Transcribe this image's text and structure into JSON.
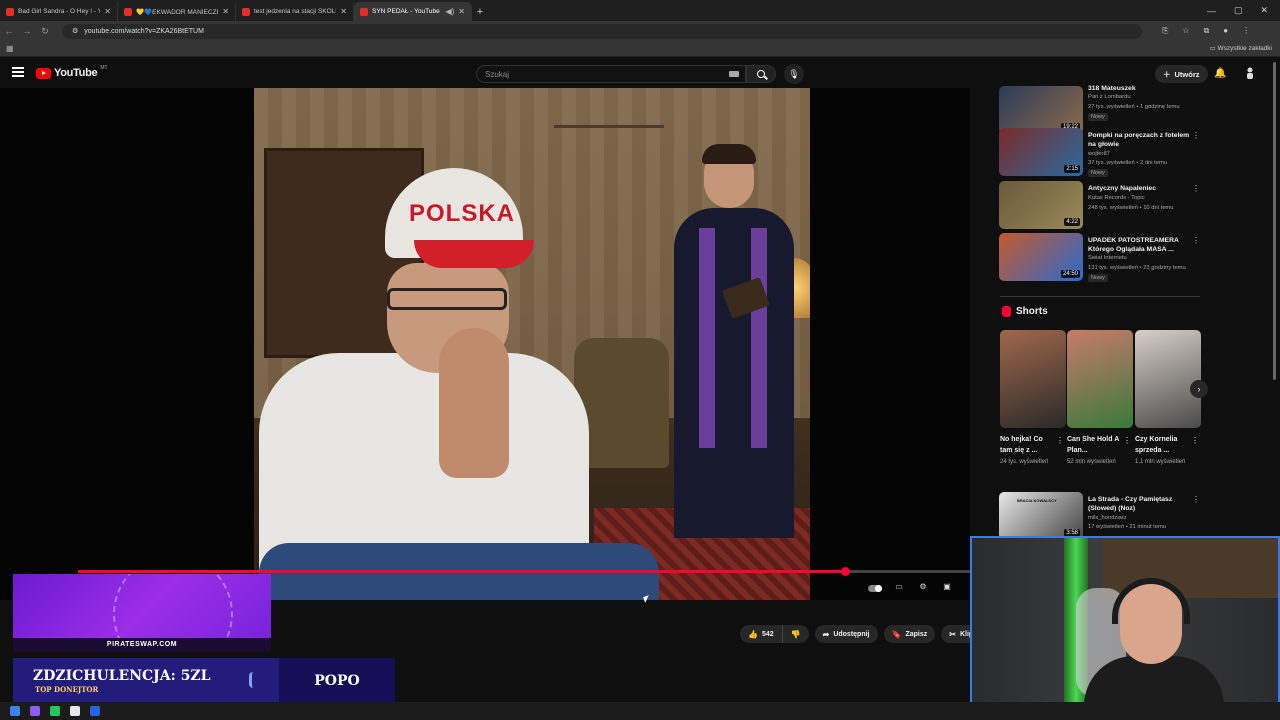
{
  "browser": {
    "tabs": [
      {
        "label": "Bad Girl Sandra - O Hey ! - You",
        "active": false
      },
      {
        "label": "💛💙EKWADOR MANIECZKI",
        "active": false
      },
      {
        "label": "test jedzenia na stacji SKOLIM",
        "active": false
      },
      {
        "label": "SYN PEDAŁ - YouTube",
        "active": true
      }
    ],
    "url": "youtube.com/watch?v=ZKA26BtETUM",
    "bookmarks_all": "Wszystkie zakładki"
  },
  "youtube": {
    "logo": "YouTube",
    "logo_sup": "MT",
    "search_placeholder": "Szukaj",
    "create_label": "Utwórz"
  },
  "video": {
    "cap_text": "POLSKA",
    "progress": 0.86
  },
  "actions": {
    "likes": "542",
    "share": "Udostępnij",
    "save": "Zapisz",
    "clip": "Klip"
  },
  "recommendations": [
    {
      "title": "318 Mateuszek",
      "channel": "Pan z Lombardu",
      "meta": "27 tys. wyświetleń • 1 godzinę temu",
      "badge": "Nowy",
      "duration": "19:22",
      "colors": [
        "#2d3a5a",
        "#8a6a4a"
      ]
    },
    {
      "title": "Pompki na poręczach z fotelem na głowie",
      "channel": "wojfer87",
      "meta": "37 tys. wyświetleń • 2 dni temu",
      "badge": "Nowy",
      "duration": "2:15",
      "colors": [
        "#7a2a2a",
        "#2a6aa0"
      ]
    },
    {
      "title": "Antyczny Napaleniec",
      "channel": "Kutas Records - Topic",
      "meta": "248 tys. wyświetleń • 10 dni temu",
      "badge": "",
      "duration": "4:22",
      "colors": [
        "#6a5a3a",
        "#9a8a5a"
      ]
    },
    {
      "title": "UPADEK PATOSTREAMERA Którego Oglądała MASA ...",
      "channel": "Świat Internetu",
      "meta": "131 tys. wyświetleń • 23 godziny temu",
      "badge": "Nowy",
      "duration": "24:50",
      "colors": [
        "#c45a2a",
        "#2a6ad0"
      ]
    }
  ],
  "shorts": {
    "heading": "Shorts",
    "items": [
      {
        "title": "No hejka! Co tam się z ...",
        "views": "24 tys. wyświetleń",
        "colors": [
          "#a0684a",
          "#2a2a2a"
        ]
      },
      {
        "title": "Can She Hold A Plan...",
        "views": "52 mln wyświetleń",
        "colors": [
          "#c87a6a",
          "#3a7a3a"
        ]
      },
      {
        "title": "Czy Kornelia sprzeda ...",
        "views": "1,1 mln wyświetleń",
        "colors": [
          "#d8d0c8",
          "#4a4a4a"
        ]
      }
    ]
  },
  "rec_bottom": {
    "title": "La Strada - Czy Pamiętasz (Slowed) (Noz)",
    "channel": "milx_hondziarz",
    "meta": "17 wyświetleń • 21 minut temu",
    "duration": "3:58",
    "thumb_label": "BRACIA KOWALSCY"
  },
  "overlay": {
    "promo_site": "PIRATESWAP.COM",
    "donor_label": "ZDZICHULENCJA: 5ZL",
    "donor_sub": "TOP DONEJTOR",
    "donor_name": "POPO"
  }
}
